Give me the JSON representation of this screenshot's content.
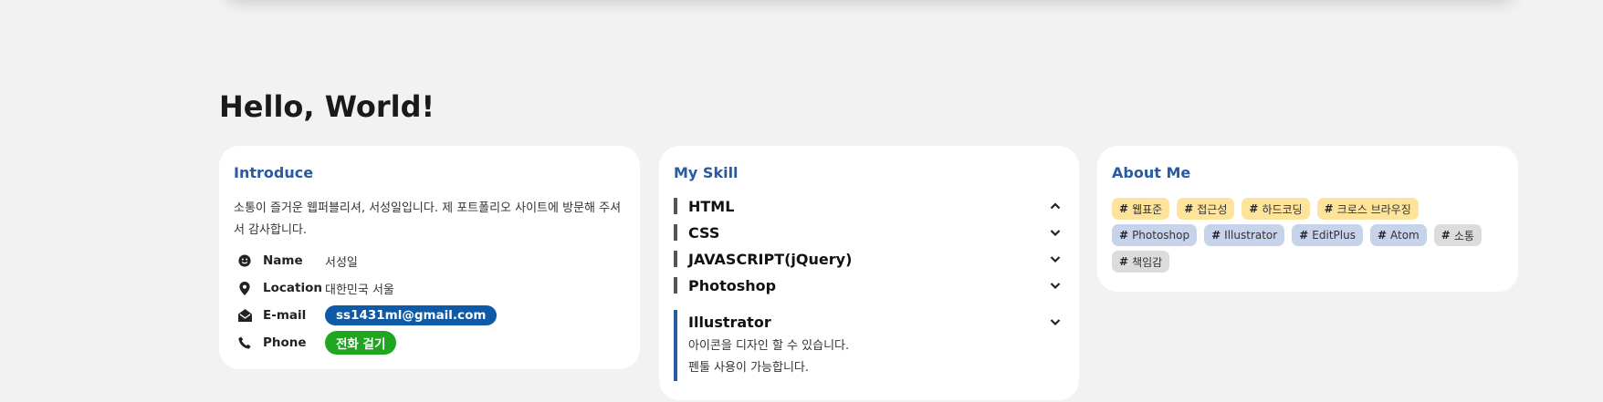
{
  "page": {
    "title": "Hello, World!"
  },
  "introduce": {
    "title": "Introduce",
    "text": "소통이 즐거운 웹퍼블리셔, 서성일입니다. 제 포트폴리오 사이트에 방문해 주셔서 감사합니다.",
    "rows": [
      {
        "icon": "smile-icon",
        "label": "Name",
        "value": "서성일"
      },
      {
        "icon": "location-pin-icon",
        "label": "Location",
        "value": "대한민국 서울"
      },
      {
        "icon": "envelope-open-icon",
        "label": "E-mail",
        "value": "ss1431ml@gmail.com"
      },
      {
        "icon": "phone-icon",
        "label": "Phone",
        "value": "전화 걸기"
      }
    ],
    "colors": {
      "email_pill": "#0e5aa6",
      "phone_pill": "#1fa51f"
    }
  },
  "skill": {
    "title": "My Skill",
    "items": [
      {
        "name": "HTML",
        "chevron": "chevron-up-icon"
      },
      {
        "name": "CSS",
        "chevron": "chevron-down-icon"
      },
      {
        "name": "JAVASCRIPT(jQuery)",
        "chevron": "chevron-down-icon"
      },
      {
        "name": "Photoshop",
        "chevron": "chevron-down-icon"
      },
      {
        "name": "Illustrator",
        "chevron": "chevron-down-icon",
        "desc": [
          "아이콘을 디자인 할 수 있습니다.",
          "펜툴 사용이 가능합니다."
        ]
      }
    ]
  },
  "about": {
    "title": "About Me",
    "tags": [
      {
        "label": "웹표준",
        "color": "yellow"
      },
      {
        "label": "접근성",
        "color": "yellow"
      },
      {
        "label": "하드코딩",
        "color": "yellow"
      },
      {
        "label": "크로스 브라우징",
        "color": "yellow"
      },
      {
        "label": "Photoshop",
        "color": "blue"
      },
      {
        "label": "Illustrator",
        "color": "blue"
      },
      {
        "label": "EditPlus",
        "color": "blue"
      },
      {
        "label": "Atom",
        "color": "blue"
      },
      {
        "label": "소통",
        "color": "gray"
      },
      {
        "label": "책임감",
        "color": "gray"
      }
    ]
  },
  "theme": {
    "accent": "#2a5aa0",
    "background": "#f2f2f2",
    "tag_yellow": "#fde49a",
    "tag_blue": "#c7d3ea",
    "tag_gray": "#dcdcdc"
  }
}
